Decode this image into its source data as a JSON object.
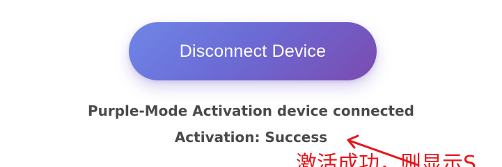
{
  "device_panel": {
    "button_label": "Disconnect Device",
    "status_connected": "Purple-Mode Activation device connected",
    "status_activation": "Activation: Success"
  },
  "annotation": {
    "note_text": "激活成功，则显示S",
    "color": "#e8141a"
  },
  "colors": {
    "button_gradient_start": "#6e86e6",
    "button_gradient_end": "#7a4bb0",
    "status_text": "#4a4a4a"
  }
}
